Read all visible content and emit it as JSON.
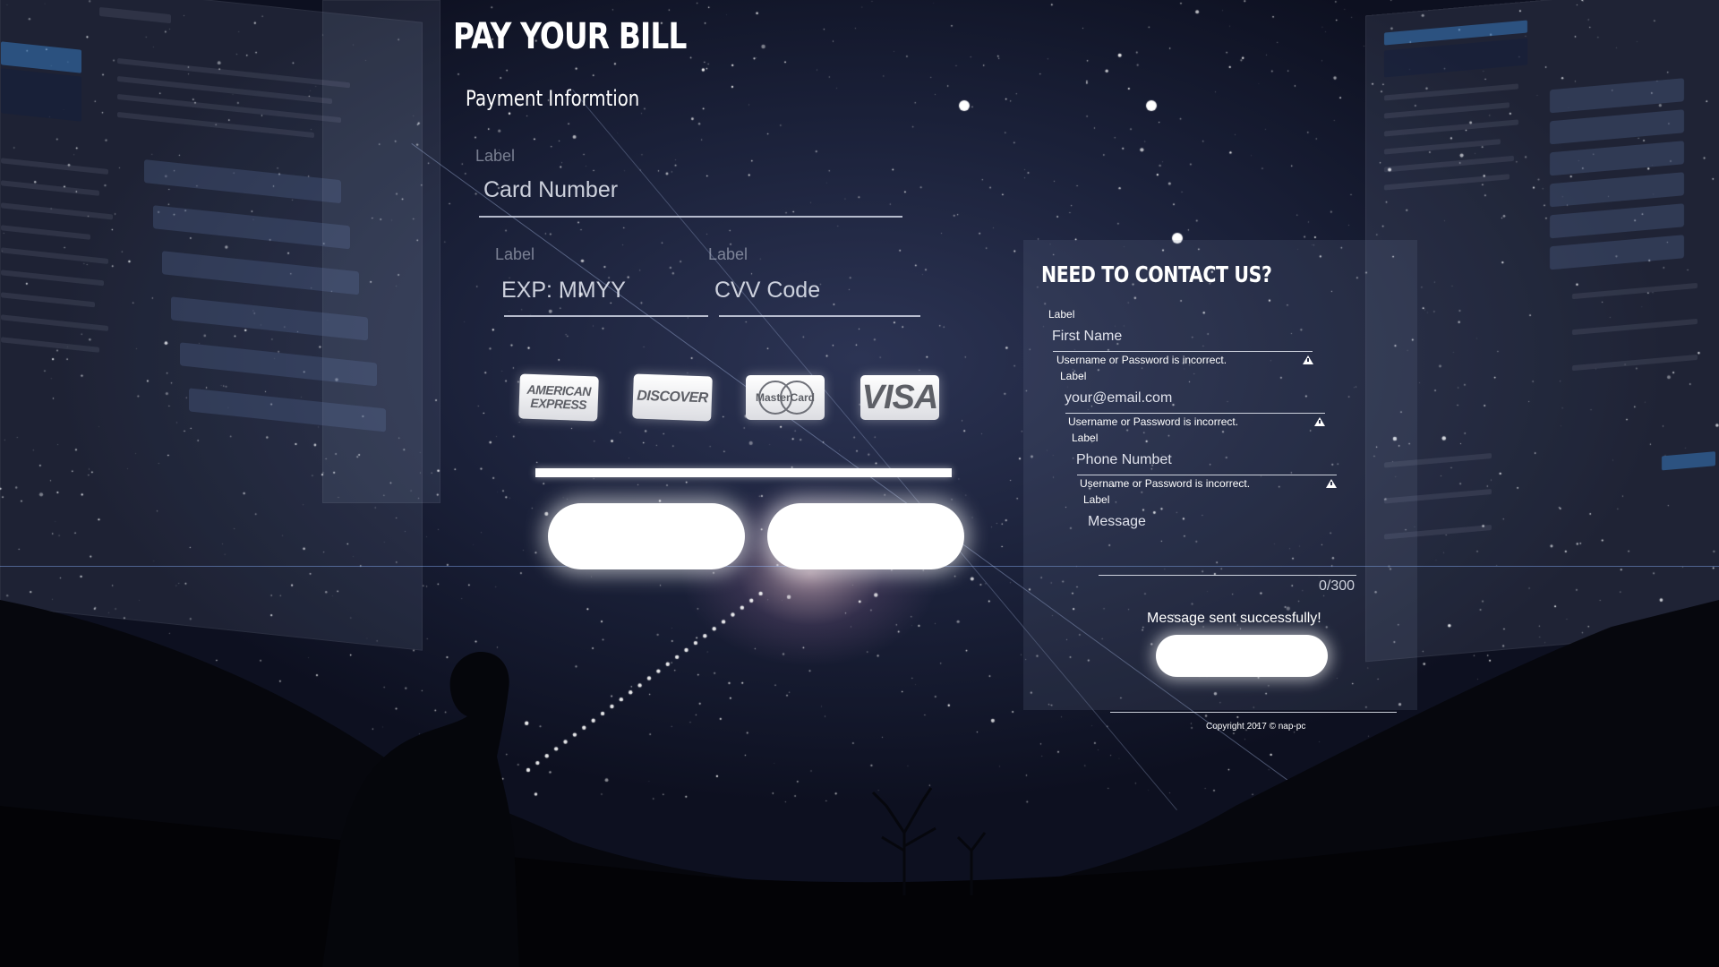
{
  "payment": {
    "title": "PAY YOUR BILL",
    "subtitle": "Payment Informtion",
    "card_number_label": "Label",
    "card_number_placeholder": "Card Number",
    "exp_label": "Label",
    "exp_placeholder": "EXP: MMYY",
    "cvv_label": "Label",
    "cvv_placeholder": "CVV Code",
    "card_logos": {
      "amex": "AMERICAN EXPRESS",
      "discover": "DISCOVER",
      "mastercard": "MasterCard",
      "visa": "VISA"
    }
  },
  "contact": {
    "title": "NEED TO CONTACT US?",
    "first_name_label": "Label",
    "first_name_placeholder": "First Name",
    "first_name_error": "Username or Password is incorrect.",
    "email_label": "Label",
    "email_placeholder": "your@email.com",
    "email_error": "Username or Password is incorrect.",
    "phone_label": "Label",
    "phone_placeholder": "Phone Numbet",
    "phone_error": "Username or Password is incorrect.",
    "message_label": "Label",
    "message_placeholder": "Message",
    "char_counter": "0/300",
    "success_message": "Message sent successfully!",
    "copyright": "Copyright 2017 © nap-pc"
  },
  "colors": {
    "text": "#ffffff",
    "background_sky": "#1a2038",
    "button_fill": "#ffffff"
  },
  "icons": [
    "warning-icon",
    "amex-logo-icon",
    "discover-logo-icon",
    "mastercard-logo-icon",
    "visa-logo-icon"
  ]
}
